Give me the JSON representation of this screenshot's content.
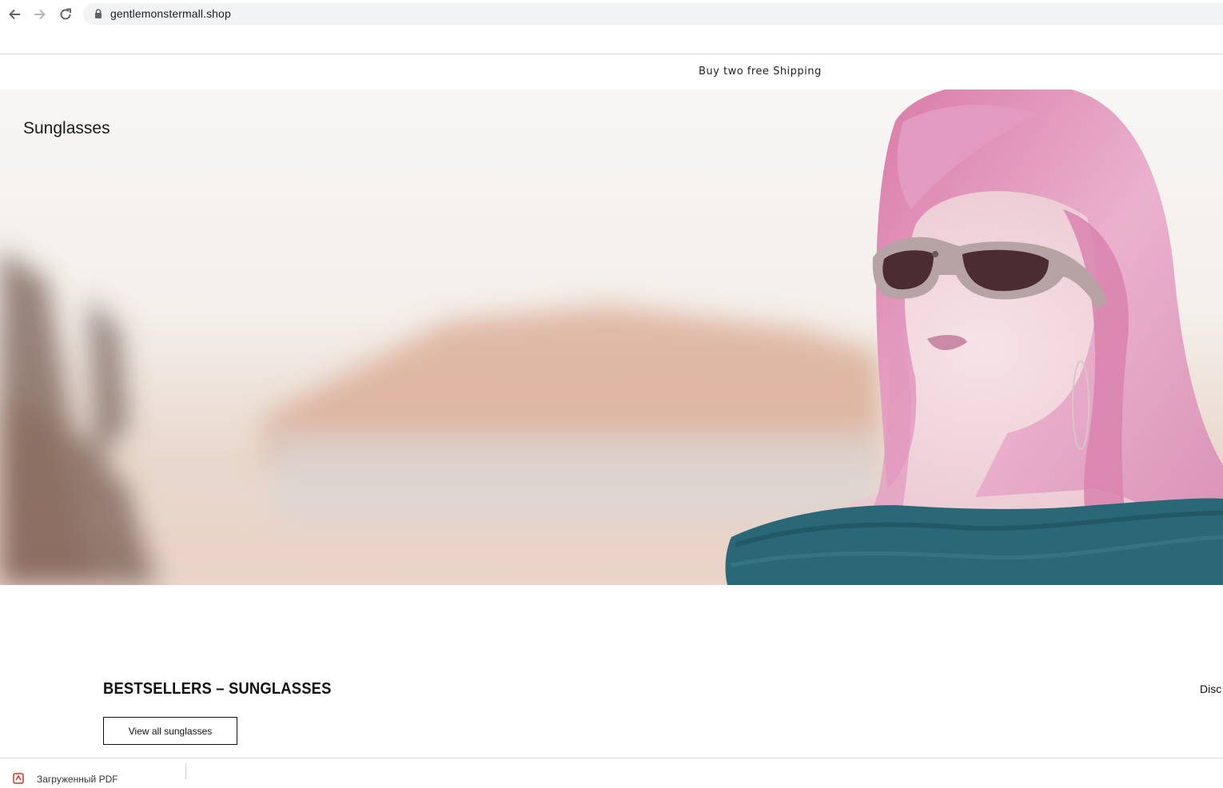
{
  "browser": {
    "url": "gentlemonstermall.shop",
    "back_icon": "back-arrow-icon",
    "forward_icon": "forward-arrow-icon",
    "reload_icon": "reload-icon",
    "lock_icon": "lock-icon"
  },
  "announcement": {
    "text": "Buy two free Shipping"
  },
  "hero": {
    "title": "Sunglasses",
    "image_alt": "Woman with pink hair wearing sunglasses"
  },
  "bestsellers": {
    "title": "BESTSELLERS – SUNGLASSES",
    "side_link": "Disc",
    "button_label": "View all sunglasses"
  },
  "download_bar": {
    "file_label": "Загруженный PDF"
  },
  "colors": {
    "hair": "#e9a9c7",
    "sweater": "#2b6877",
    "frame": "#b8a3a4"
  }
}
